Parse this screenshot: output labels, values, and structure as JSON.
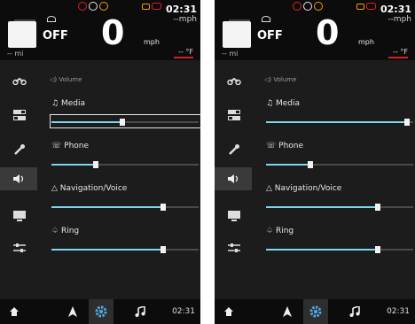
{
  "colors": {
    "accent": "#7fd6e8",
    "warning_red": "#e02020",
    "warning_amber": "#f0a000",
    "background": "#1c1c1c",
    "header": "#0c0c0c"
  },
  "screens": [
    {
      "header": {
        "time": "02:31",
        "sub_speed": "--mph",
        "cruise_state": "OFF",
        "speed": "0",
        "speed_unit": "mph",
        "odometer": "-- mi",
        "temperature": "-- °F"
      },
      "sidebar": {
        "icons": [
          "motorcycle-icon",
          "toggles-icon",
          "wrench-icon",
          "speaker-icon",
          "display-icon",
          "sliders-icon"
        ],
        "active_index": 3
      },
      "volume": {
        "title": "Volume",
        "sliders": [
          {
            "label": "Media",
            "level": 0.48,
            "focused": true
          },
          {
            "label": "Phone",
            "level": 0.3,
            "focused": false
          },
          {
            "label": "Navigation/Voice",
            "level": 0.76,
            "focused": false
          },
          {
            "label": "Ring",
            "level": 0.76,
            "focused": false
          }
        ]
      },
      "bottom_bar": {
        "icons": [
          "home-icon",
          "navigation-icon",
          "settings-icon",
          "music-icon"
        ],
        "active_index": 2,
        "time": "02:31"
      }
    },
    {
      "header": {
        "time": "02:31",
        "sub_speed": "--mph",
        "cruise_state": "OFF",
        "speed": "0",
        "speed_unit": "mph",
        "odometer": "-- mi",
        "temperature": "-- °F"
      },
      "sidebar": {
        "icons": [
          "motorcycle-icon",
          "toggles-icon",
          "wrench-icon",
          "speaker-icon",
          "display-icon",
          "sliders-icon"
        ],
        "active_index": 3
      },
      "volume": {
        "title": "Volume",
        "sliders": [
          {
            "label": "Media",
            "level": 0.96,
            "focused": false
          },
          {
            "label": "Phone",
            "level": 0.3,
            "focused": false
          },
          {
            "label": "Navigation/Voice",
            "level": 0.76,
            "focused": false
          },
          {
            "label": "Ring",
            "level": 0.76,
            "focused": false
          }
        ]
      },
      "bottom_bar": {
        "icons": [
          "home-icon",
          "navigation-icon",
          "settings-icon",
          "music-icon"
        ],
        "active_index": 2,
        "time": "02:31"
      }
    }
  ]
}
